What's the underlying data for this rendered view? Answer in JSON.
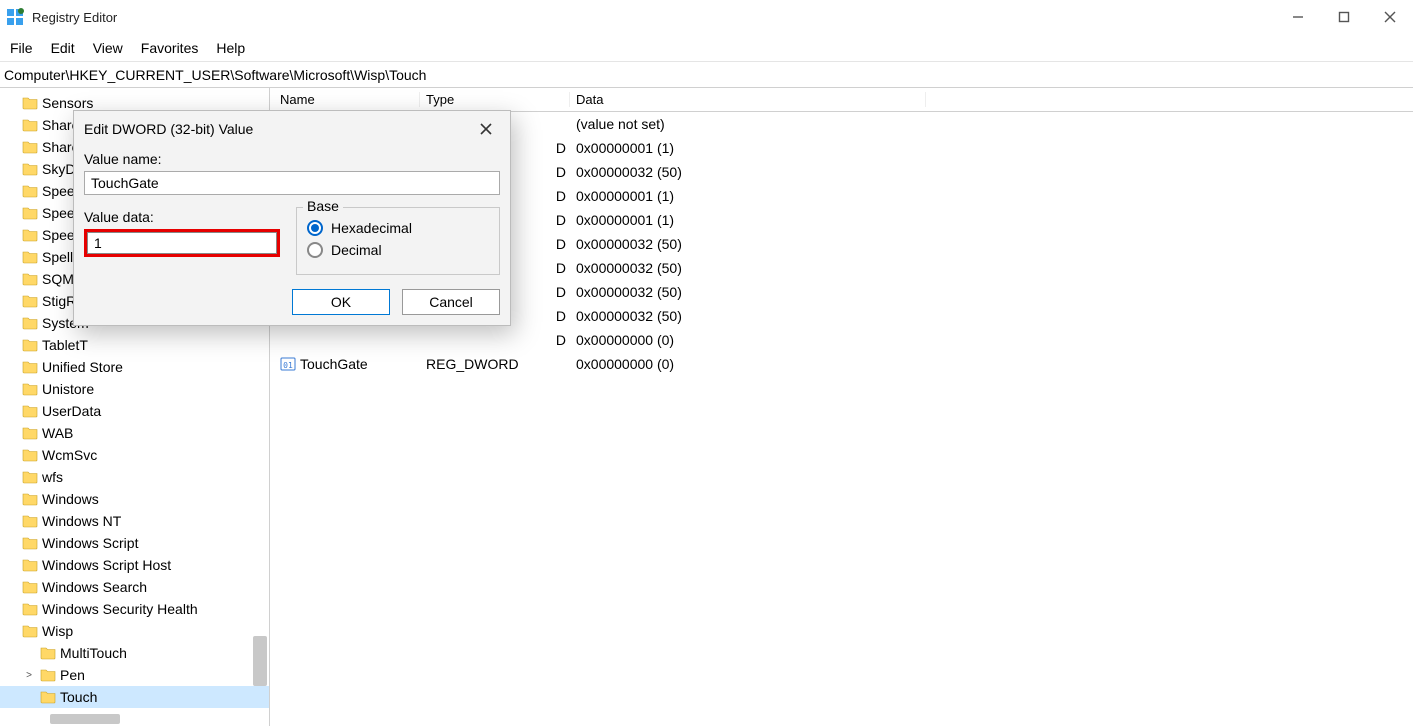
{
  "window": {
    "title": "Registry Editor"
  },
  "menubar": [
    "File",
    "Edit",
    "View",
    "Favorites",
    "Help"
  ],
  "address": "Computer\\HKEY_CURRENT_USER\\Software\\Microsoft\\Wisp\\Touch",
  "tree": [
    {
      "label": "Sensors",
      "indent": 0
    },
    {
      "label": "Shared",
      "indent": 0
    },
    {
      "label": "Shared",
      "indent": 0
    },
    {
      "label": "SkyDriv",
      "indent": 0
    },
    {
      "label": "Speech",
      "indent": 0
    },
    {
      "label": "Speech",
      "indent": 0
    },
    {
      "label": "Speech",
      "indent": 0
    },
    {
      "label": "Spelling",
      "indent": 0
    },
    {
      "label": "SQMCli",
      "indent": 0
    },
    {
      "label": "StigReg",
      "indent": 0
    },
    {
      "label": "System",
      "indent": 0
    },
    {
      "label": "TabletT",
      "indent": 0
    },
    {
      "label": "Unified Store",
      "indent": 0
    },
    {
      "label": "Unistore",
      "indent": 0
    },
    {
      "label": "UserData",
      "indent": 0
    },
    {
      "label": "WAB",
      "indent": 0
    },
    {
      "label": "WcmSvc",
      "indent": 0
    },
    {
      "label": "wfs",
      "indent": 0
    },
    {
      "label": "Windows",
      "indent": 0
    },
    {
      "label": "Windows NT",
      "indent": 0
    },
    {
      "label": "Windows Script",
      "indent": 0
    },
    {
      "label": "Windows Script Host",
      "indent": 0
    },
    {
      "label": "Windows Search",
      "indent": 0
    },
    {
      "label": "Windows Security Health",
      "indent": 0
    },
    {
      "label": "Wisp",
      "indent": 0
    },
    {
      "label": "MultiTouch",
      "indent": 1
    },
    {
      "label": "Pen",
      "indent": 1,
      "expander": ">"
    },
    {
      "label": "Touch",
      "indent": 1,
      "selected": true
    }
  ],
  "columns": {
    "name": "Name",
    "type": "Type",
    "data": "Data"
  },
  "rows": [
    {
      "name": "",
      "type": "",
      "data": "(value not set)"
    },
    {
      "name": "",
      "type": "D",
      "data": "0x00000001 (1)"
    },
    {
      "name": "",
      "type": "D",
      "data": "0x00000032 (50)"
    },
    {
      "name": "",
      "type": "D",
      "data": "0x00000001 (1)"
    },
    {
      "name": "",
      "type": "D",
      "data": "0x00000001 (1)"
    },
    {
      "name": "",
      "type": "D",
      "data": "0x00000032 (50)"
    },
    {
      "name": "",
      "type": "D",
      "data": "0x00000032 (50)"
    },
    {
      "name": "",
      "type": "D",
      "data": "0x00000032 (50)"
    },
    {
      "name": "",
      "type": "D",
      "data": "0x00000032 (50)"
    },
    {
      "name": "",
      "type": "D",
      "data": "0x00000000 (0)"
    },
    {
      "name": "TouchGate",
      "type": "REG_DWORD",
      "data": "0x00000000 (0)",
      "icon": true
    }
  ],
  "dialog": {
    "title": "Edit DWORD (32-bit) Value",
    "value_name_label": "Value name:",
    "value_name": "TouchGate",
    "value_data_label": "Value data:",
    "value_data": "1",
    "base_label": "Base",
    "hex_label": "Hexadecimal",
    "dec_label": "Decimal",
    "ok": "OK",
    "cancel": "Cancel"
  }
}
